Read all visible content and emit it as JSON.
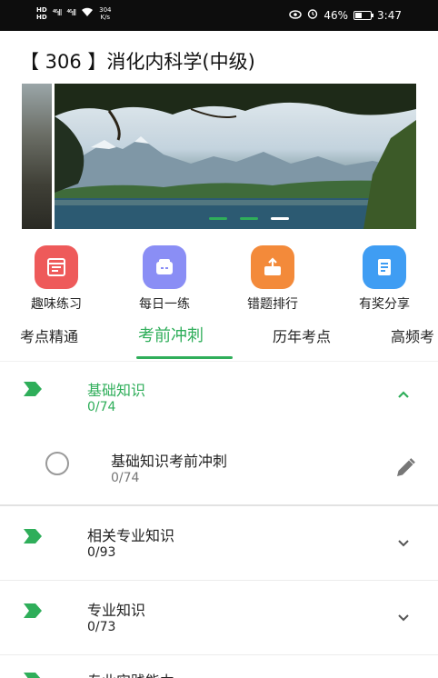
{
  "status_bar": {
    "hd_label": "HD",
    "signal1": "⁴⁶ıll",
    "signal2": "⁴⁶ıll",
    "speed_value": "304",
    "speed_unit": "K/s",
    "battery": "46%",
    "battery_level": 0.46,
    "time": "3:47"
  },
  "page": {
    "title": "【 306 】消化内科学(中级)"
  },
  "quick_actions": [
    {
      "label": "趣味练习",
      "icon": "practice-icon",
      "color": "#ee5a5a"
    },
    {
      "label": "每日一练",
      "icon": "daily-icon",
      "color": "#8a8ef5"
    },
    {
      "label": "错题排行",
      "icon": "ranking-icon",
      "color": "#f38a3a"
    },
    {
      "label": "有奖分享",
      "icon": "share-icon",
      "color": "#3f9df3"
    }
  ],
  "tabs": [
    {
      "label": "考点精通",
      "active": false
    },
    {
      "label": "考前冲刺",
      "active": true
    },
    {
      "label": "历年考点",
      "active": false
    },
    {
      "label": "高频考",
      "active": false
    }
  ],
  "sections": [
    {
      "title": "基础知识",
      "count": "0/74",
      "expanded": true,
      "children": [
        {
          "title": "基础知识考前冲刺",
          "count": "0/74"
        }
      ]
    },
    {
      "title": "相关专业知识",
      "count": "0/93",
      "expanded": false
    },
    {
      "title": "专业知识",
      "count": "0/73",
      "expanded": false
    },
    {
      "title": "专业实践能力",
      "count": "",
      "expanded": false
    }
  ],
  "colors": {
    "accent": "#2fae5a",
    "status_bar": "#0d0d0d"
  }
}
